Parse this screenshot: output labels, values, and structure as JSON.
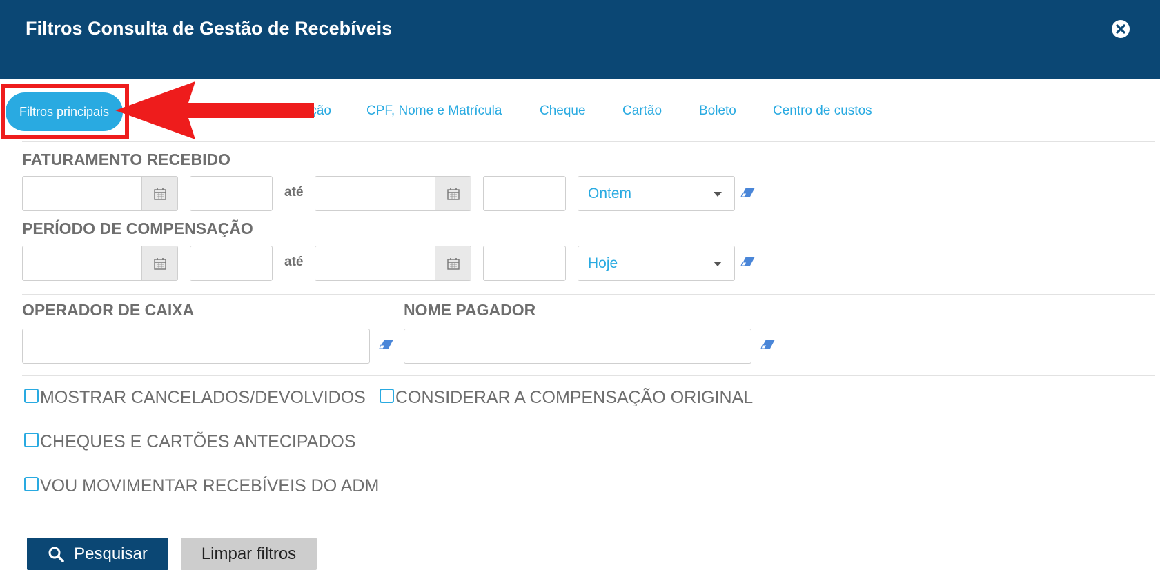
{
  "header": {
    "title": "Filtros Consulta de Gestão de Recebíveis"
  },
  "tabs": {
    "active": "Filtros principais",
    "partial": "ção",
    "items": [
      "CPF, Nome e Matrícula",
      "Cheque",
      "Cartão",
      "Boleto",
      "Centro de custos"
    ]
  },
  "faturamento": {
    "label": "FATURAMENTO RECEBIDO",
    "ate": "até",
    "period": "Ontem"
  },
  "compensacao": {
    "label": "PERÍODO DE COMPENSAÇÃO",
    "ate": "até",
    "period": "Hoje"
  },
  "operador": {
    "label": "OPERADOR DE CAIXA",
    "value": ""
  },
  "pagador": {
    "label": "NOME PAGADOR",
    "value": ""
  },
  "checks": {
    "cancelados": "MOSTRAR CANCELADOS/DEVOLVIDOS",
    "compensacao_original": "CONSIDERAR A COMPENSAÇÃO ORIGINAL",
    "antecipados": "CHEQUES E CARTÕES ANTECIPADOS",
    "adm": "VOU MOVIMENTAR RECEBÍVEIS DO ADM"
  },
  "buttons": {
    "search": "Pesquisar",
    "clear": "Limpar filtros"
  },
  "colors": {
    "header": "#0b4774",
    "accent": "#29aae1",
    "highlight": "#ee1c1c"
  }
}
